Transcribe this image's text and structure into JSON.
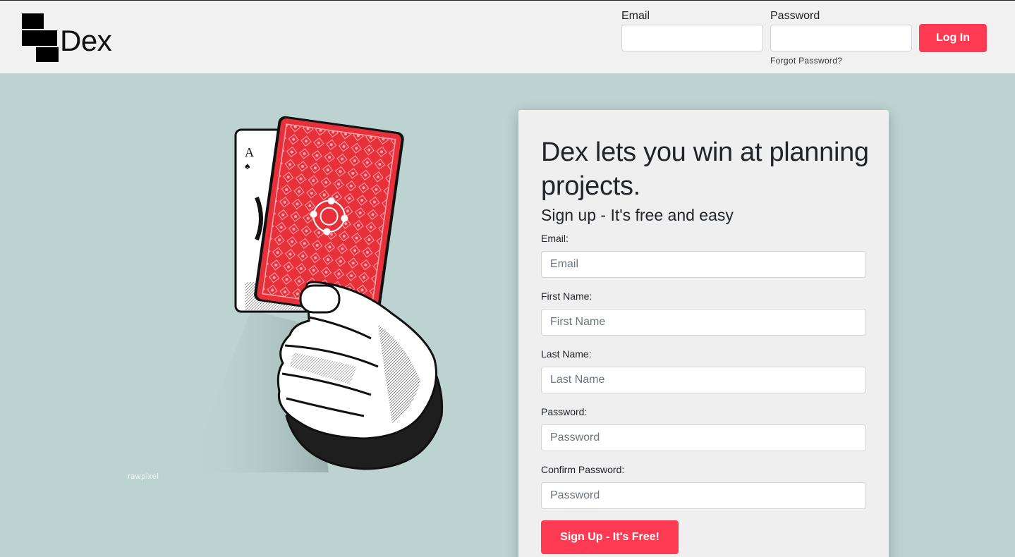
{
  "app": {
    "name": "Dex"
  },
  "header": {
    "email_label": "Email",
    "password_label": "Password",
    "email_value": "",
    "password_value": "",
    "login_label": "Log In",
    "forgot_label": "Forgot Password?"
  },
  "hero": {
    "watermark": "rawpixel",
    "card_rank": "A",
    "card_suit": "♠"
  },
  "signup": {
    "headline": "Dex lets you win at planning projects.",
    "subhead": "Sign up - It's free and easy",
    "fields": [
      {
        "label": "Email:",
        "placeholder": "Email"
      },
      {
        "label": "First Name:",
        "placeholder": "First Name"
      },
      {
        "label": "Last Name:",
        "placeholder": "Last Name"
      },
      {
        "label": "Password:",
        "placeholder": "Password"
      },
      {
        "label": "Confirm Password:",
        "placeholder": "Password"
      }
    ],
    "submit_label": "Sign Up - It's Free!"
  },
  "colors": {
    "accent": "#ff3b53",
    "background": "#bcd3d2",
    "navbar": "#f1f1f1",
    "card_red": "#e8303a"
  }
}
